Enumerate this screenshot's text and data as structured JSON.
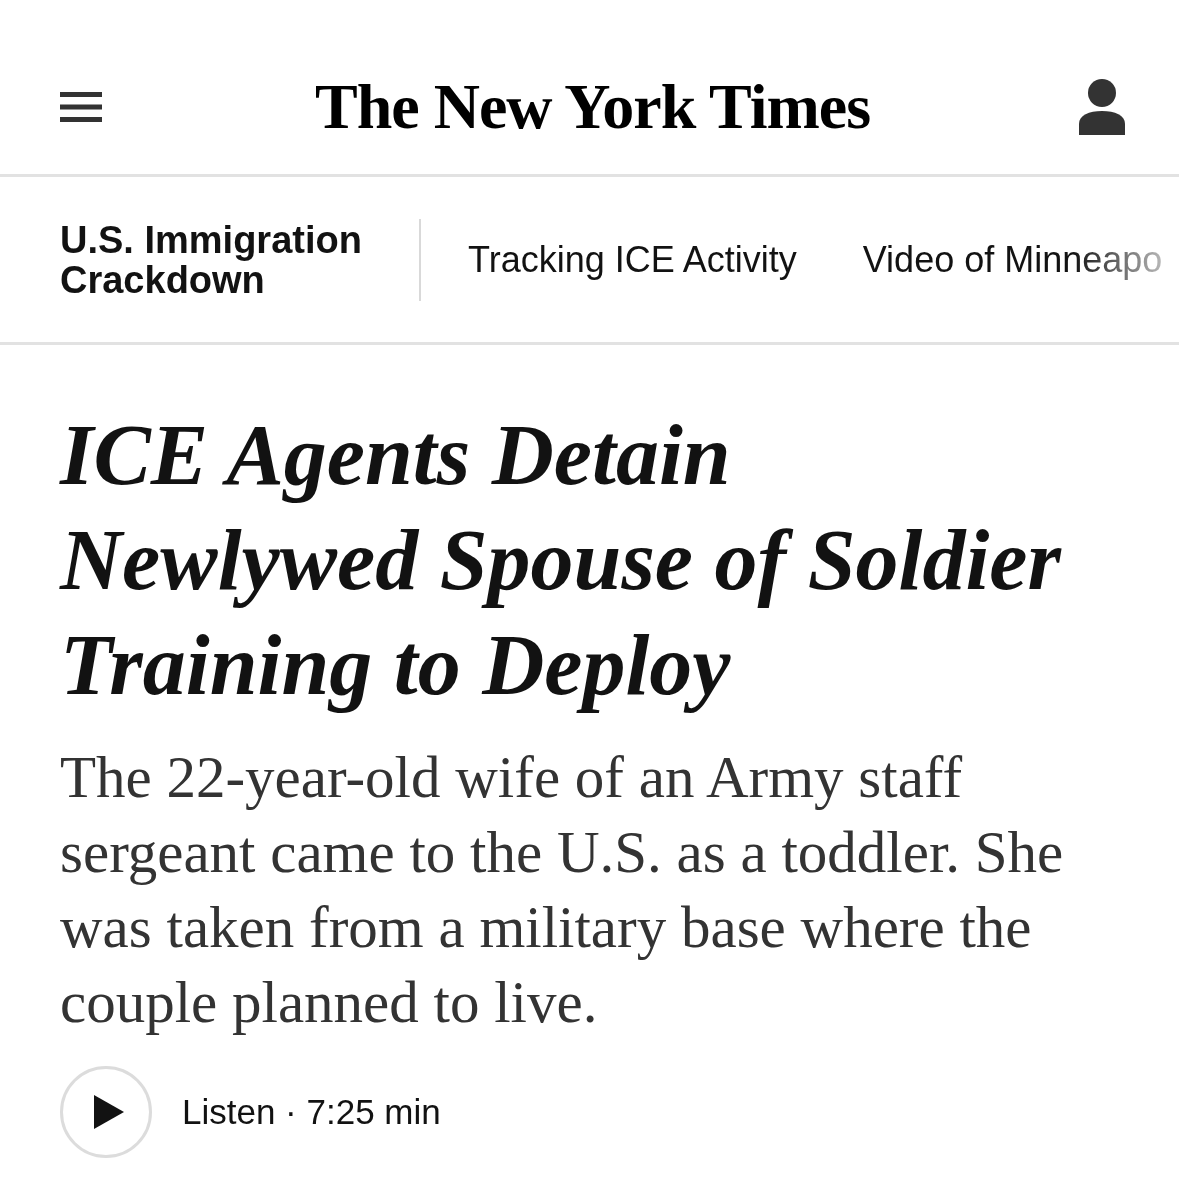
{
  "header": {
    "logo": "The New York Times"
  },
  "section_nav": {
    "section": "U.S. Immigration Crackdown",
    "links": [
      "Tracking ICE Activity",
      "Video of Minneapo"
    ]
  },
  "article": {
    "headline": "ICE Agents Detain Newlywed Spouse of Soldier Training to Deploy",
    "summary": "The 22-year-old wife of an Army staff sergeant came to the U.S. as a toddler. She was taken from a military base where the couple planned to live.",
    "listen": {
      "label": "Listen · 7:25 min"
    }
  }
}
